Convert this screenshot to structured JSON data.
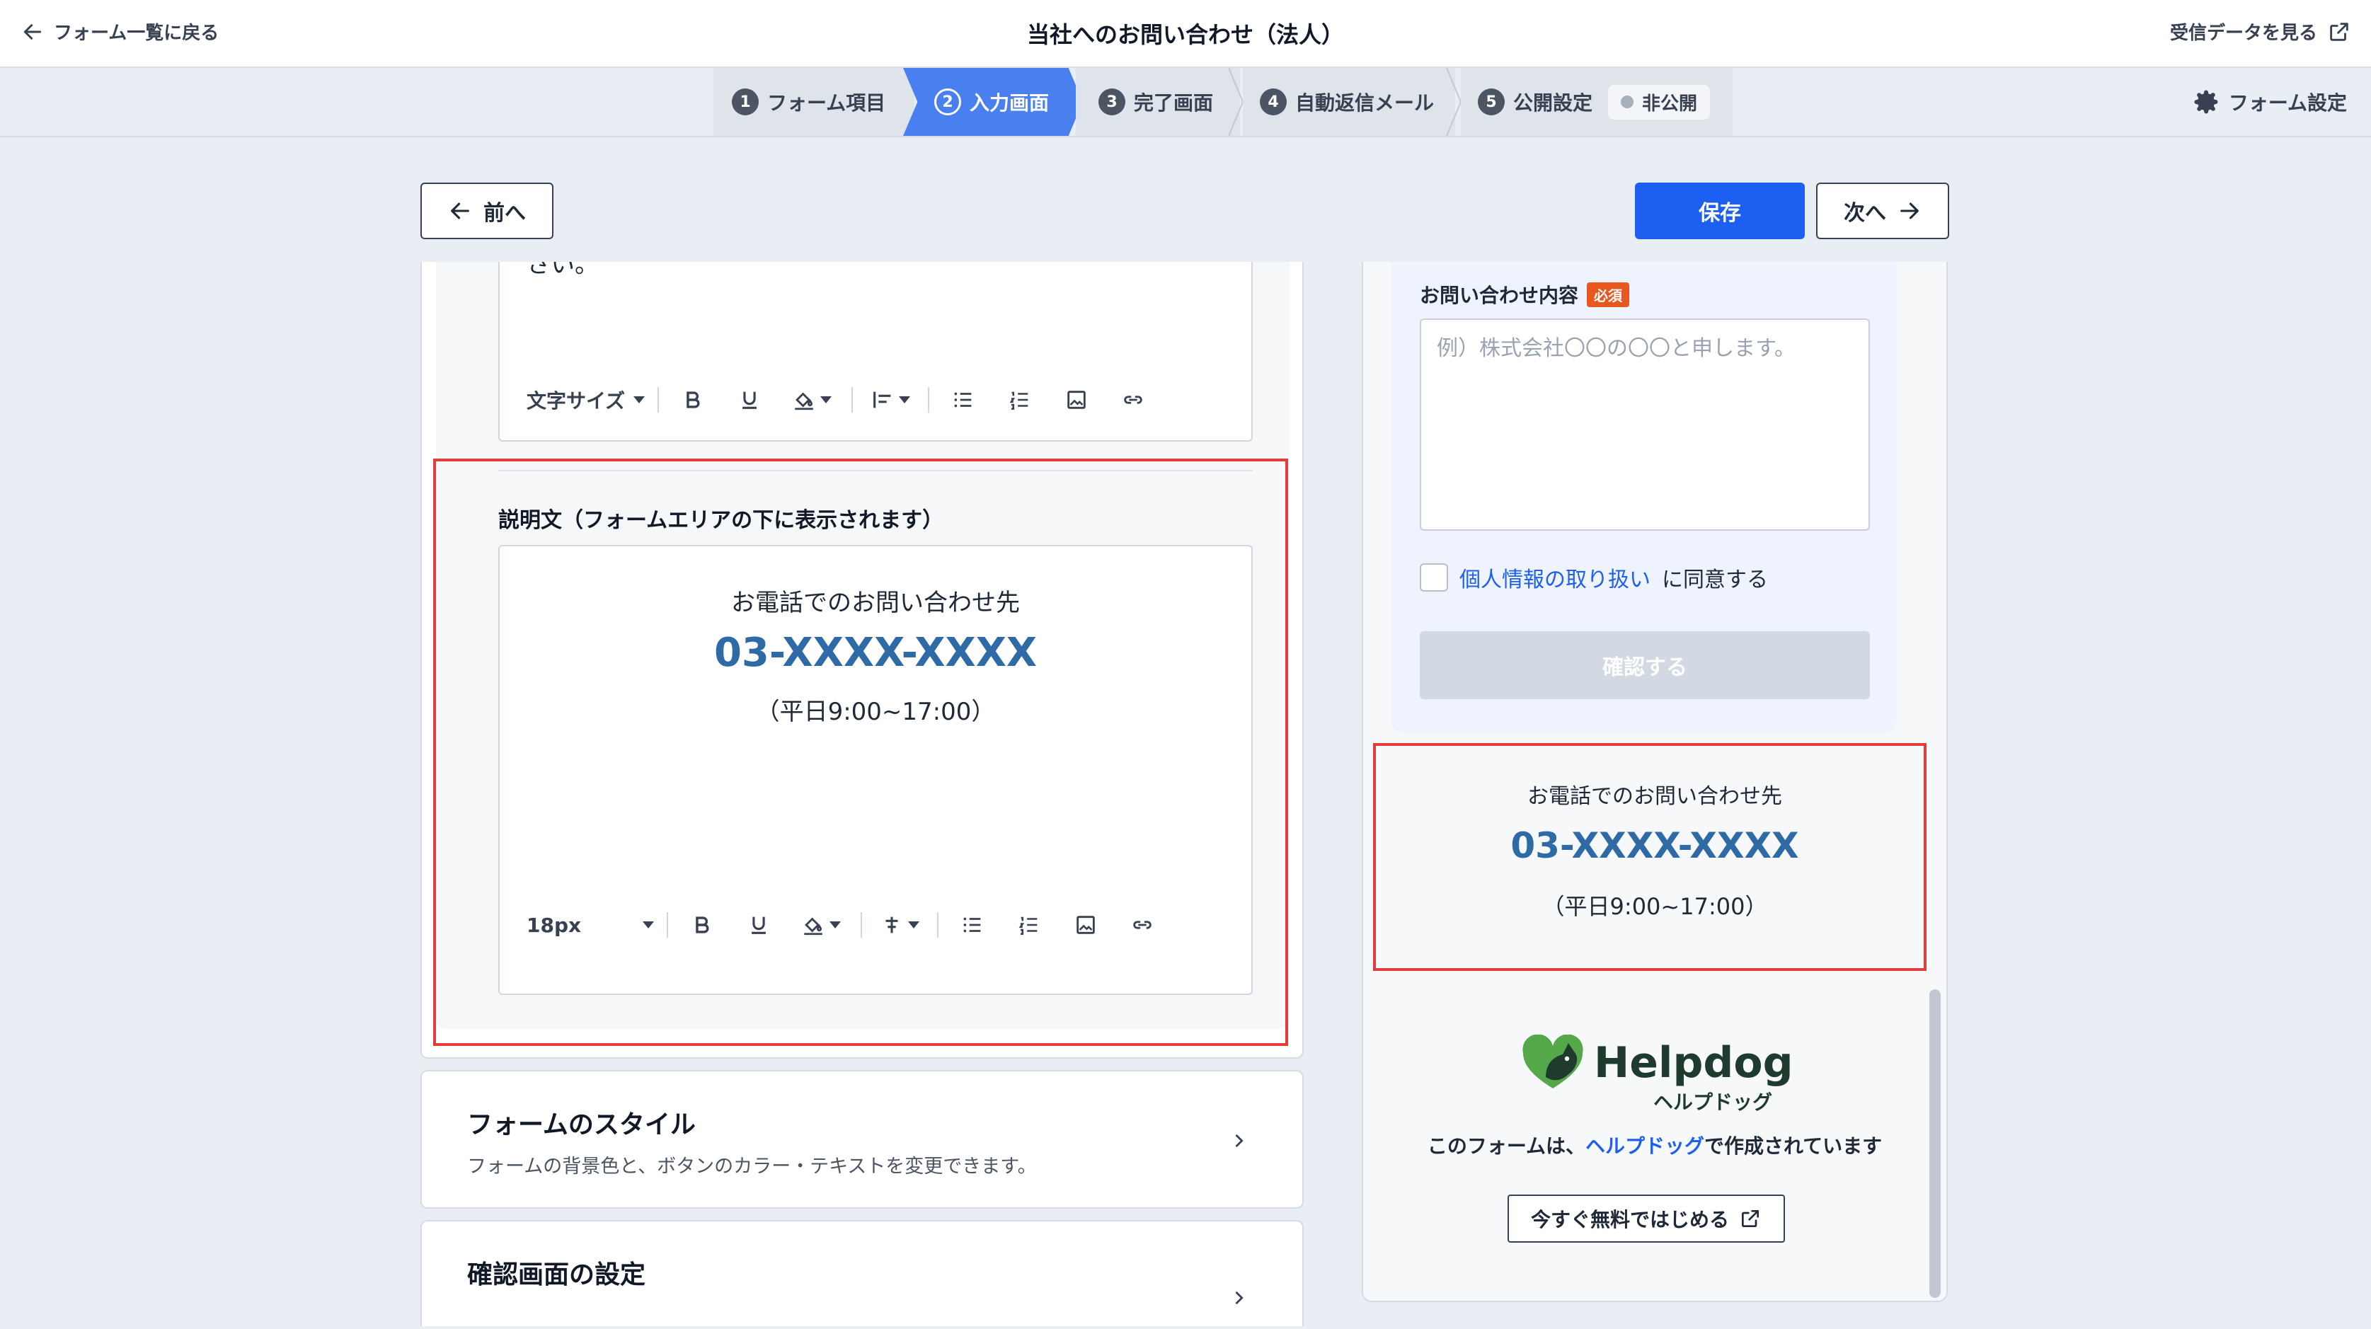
{
  "header": {
    "back_label": "フォーム一覧に戻る",
    "title": "当社へのお問い合わせ（法人）",
    "view_data_label": "受信データを見る"
  },
  "steps": [
    {
      "num": "1",
      "label": "フォーム項目"
    },
    {
      "num": "2",
      "label": "入力画面"
    },
    {
      "num": "3",
      "label": "完了画面"
    },
    {
      "num": "4",
      "label": "自動返信メール"
    },
    {
      "num": "5",
      "label": "公開設定"
    }
  ],
  "publish_status": "非公開",
  "form_settings_label": "フォーム設定",
  "nav": {
    "prev_label": "前へ",
    "save_label": "保存",
    "next_label": "次へ"
  },
  "editor_top": {
    "cut_text": "さい。",
    "font_size_label": "文字サイズ"
  },
  "description": {
    "label": "説明文（フォームエリアの下に表示されます）",
    "line1": "お電話でのお問い合わせ先",
    "line2": "03-XXXX-XXXX",
    "line3": "（平日9:00~17:00）",
    "font_size_value": "18px"
  },
  "cards": [
    {
      "title": "フォームのスタイル",
      "subtitle": "フォームの背景色と、ボタンのカラー・テキストを変更できます。"
    },
    {
      "title": "確認画面の設定",
      "subtitle": ""
    }
  ],
  "preview": {
    "field_label": "お問い合わせ内容",
    "required_badge": "必須",
    "placeholder": "例）株式会社〇〇の〇〇と申します。",
    "consent_link": "個人情報の取り扱い",
    "consent_text": "に同意する",
    "confirm_label": "確認する",
    "desc_line1": "お電話でのお問い合わせ先",
    "desc_line2": "03-XXXX-XXXX",
    "desc_line3": "（平日9:00~17:00）"
  },
  "branding": {
    "logo_text": "Helpdog",
    "logo_sub": "ヘルプドッグ",
    "made_by_prefix": "このフォームは、",
    "made_by_link": "ヘルプドッグ",
    "made_by_suffix": "で作成されています",
    "start_label": "今すぐ無料ではじめる"
  },
  "colors": {
    "accent": "#1d5ff0",
    "step_active": "#4a7ff0",
    "highlight": "#e33c3c",
    "phone_text": "#2e6aa5",
    "required": "#e8571e"
  }
}
